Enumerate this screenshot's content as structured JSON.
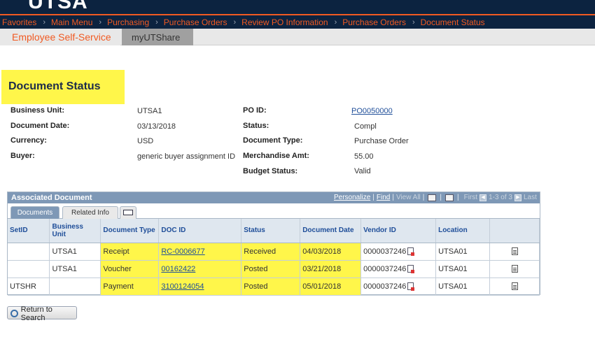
{
  "header": {
    "logo_fragment": "UTSA"
  },
  "breadcrumb": [
    "Favorites",
    "Main Menu",
    "Purchasing",
    "Purchase Orders",
    "Review PO Information",
    "Purchase Orders",
    "Document Status"
  ],
  "tabs": {
    "ess": "Employee Self-Service",
    "myutshare": "myUTShare"
  },
  "page": {
    "title": "Document Status"
  },
  "fields": {
    "business_unit_label": "Business Unit:",
    "business_unit": "UTSA1",
    "document_date_label": "Document Date:",
    "document_date": "03/13/2018",
    "currency_label": "Currency:",
    "currency": "USD",
    "buyer_label": "Buyer:",
    "buyer": "generic buyer assignment ID",
    "po_id_label": "PO ID:",
    "po_id": "PO0050000",
    "status_label": "Status:",
    "status": "Compl",
    "document_type_label": "Document Type:",
    "document_type": "Purchase Order",
    "merch_amt_label": "Merchandise Amt:",
    "merch_amt": "55.00",
    "budget_status_label": "Budget Status:",
    "budget_status": "Valid"
  },
  "grid": {
    "title": "Associated Document",
    "personalize": "Personalize",
    "find": "Find",
    "view_all": "View All",
    "first": "First",
    "range": "1-3 of 3",
    "last": "Last",
    "subtab_documents": "Documents",
    "subtab_related": "Related Info",
    "columns": [
      "SetID",
      "Business Unit",
      "Document Type",
      "DOC ID",
      "Status",
      "Document Date",
      "Vendor ID",
      "Location",
      ""
    ],
    "rows": [
      {
        "setid": "",
        "bu": "UTSA1",
        "doctype": "Receipt",
        "docid": "RC-0006677",
        "status": "Received",
        "date": "04/03/2018",
        "vendor": "0000037246",
        "location": "UTSA01"
      },
      {
        "setid": "",
        "bu": "UTSA1",
        "doctype": "Voucher",
        "docid": "00162422",
        "status": "Posted",
        "date": "03/21/2018",
        "vendor": "0000037246",
        "location": "UTSA01"
      },
      {
        "setid": "UTSHR",
        "bu": "",
        "doctype": "Payment",
        "docid": "3100124054",
        "status": "Posted",
        "date": "05/01/2018",
        "vendor": "0000037246",
        "location": "UTSA01"
      }
    ]
  },
  "buttons": {
    "return_to_search": "Return to Search"
  },
  "colors": {
    "navy": "#0c2340",
    "orange": "#f15a22",
    "highlight": "#fff64a",
    "grid_header": "#7e98b6"
  }
}
